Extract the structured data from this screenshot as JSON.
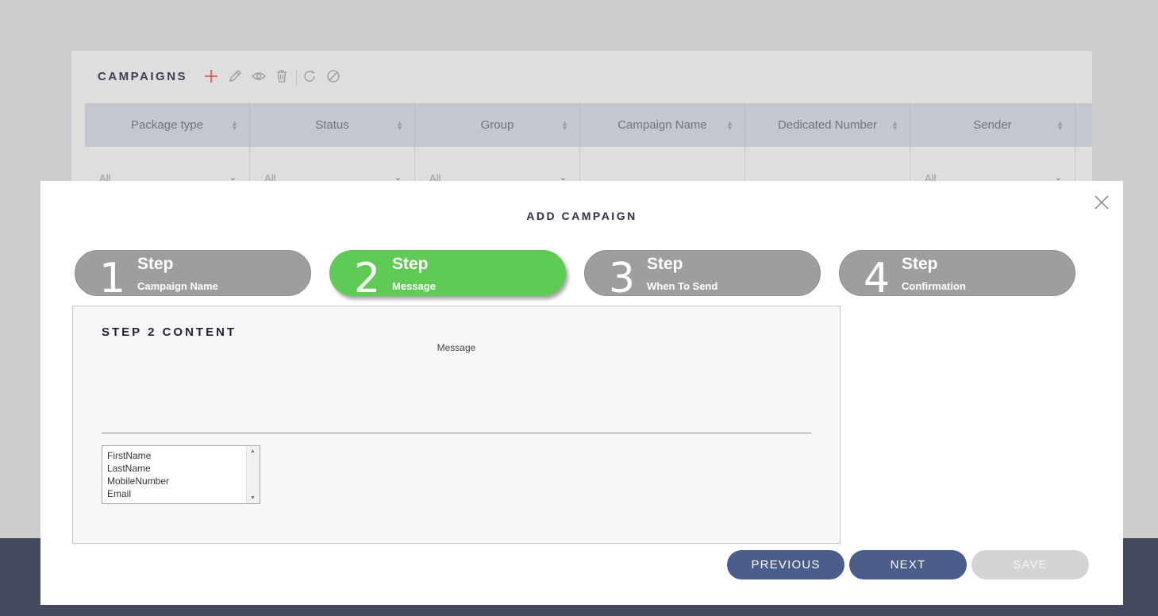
{
  "background": {
    "title": "CAMPAIGNS",
    "toolbar": [
      {
        "icon": "plus-icon",
        "color": "#e4493b"
      },
      {
        "icon": "pencil-icon",
        "color": "#9a9a9a"
      },
      {
        "icon": "eye-icon",
        "color": "#9a9a9a"
      },
      {
        "icon": "trash-icon",
        "color": "#9a9a9a"
      },
      {
        "icon": "refresh-icon",
        "color": "#9a9a9a"
      },
      {
        "icon": "block-icon",
        "color": "#9a9a9a"
      }
    ],
    "columns": [
      "Package type",
      "Status",
      "Group",
      "Campaign Name",
      "Dedicated Number",
      "Sender"
    ],
    "filters": [
      "All",
      "All",
      "All",
      "",
      "",
      "All"
    ]
  },
  "modal": {
    "title": "ADD CAMPAIGN",
    "steps": [
      {
        "num": "1",
        "title": "Step",
        "sub": "Campaign Name",
        "active": false
      },
      {
        "num": "2",
        "title": "Step",
        "sub": "Message",
        "active": true
      },
      {
        "num": "3",
        "title": "Step",
        "sub": "When To Send",
        "active": false
      },
      {
        "num": "4",
        "title": "Step",
        "sub": "Confirmation",
        "active": false
      }
    ],
    "content": {
      "title": "STEP 2 CONTENT",
      "message_label": "Message",
      "message_value": "",
      "fields": [
        "FirstName",
        "LastName",
        "MobileNumber",
        "Email"
      ]
    },
    "buttons": {
      "previous": "PREVIOUS",
      "next": "NEXT",
      "save": "SAVE"
    }
  },
  "colors": {
    "active_step": "#5fcb55",
    "inactive_step": "#9e9e9e",
    "primary_button": "#4b5d8c",
    "disabled_button": "#d4d4d4",
    "footer": "#454a5e"
  }
}
